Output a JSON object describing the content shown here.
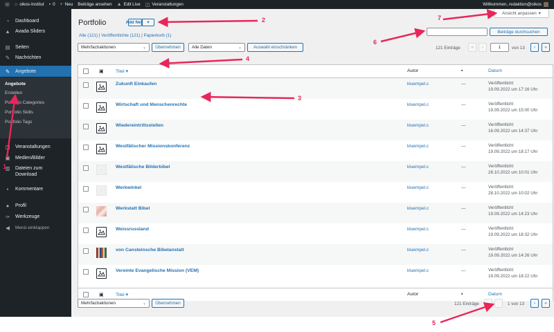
{
  "adminbar": {
    "site_name": "oikos-Institut",
    "comments_count": "0",
    "new_label": "Neu",
    "view_posts": "Beiträge ansehen",
    "edit_live": "Edit Live",
    "events": "Veranstaltungen",
    "greeting": "Willkommen, redaktion@oikos"
  },
  "sidebar": {
    "items": [
      {
        "label": "Dashboard",
        "icon": "dashboard-icon"
      },
      {
        "label": "Avada Sliders",
        "icon": "avada-icon"
      },
      {
        "label": "Seiten",
        "icon": "pages-icon"
      },
      {
        "label": "Nachrichten",
        "icon": "pin-icon"
      },
      {
        "label": "Angebote",
        "icon": "pin-icon"
      }
    ],
    "submenu": [
      "Angebote",
      "Erstellen",
      "Portfolio Categories",
      "Portfolio Skills",
      "Portfolio Tags"
    ],
    "items2": [
      {
        "label": "Veranstaltungen",
        "icon": "calendar-icon"
      },
      {
        "label": "Medien/Bilder",
        "icon": "media-icon"
      },
      {
        "label": "Dateien zum",
        "label2": "Download",
        "icon": "download-icon"
      },
      {
        "label": "Kommentare",
        "icon": "comments-icon"
      },
      {
        "label": "Profil",
        "icon": "user-icon"
      },
      {
        "label": "Werkzeuge",
        "icon": "wrench-icon"
      },
      {
        "label": "Menü einklappen",
        "icon": "collapse-icon"
      }
    ]
  },
  "header": {
    "title": "Portfolio",
    "add_new": "Add New",
    "screen_options": "Ansicht anpassen",
    "filters": {
      "all": "Alle (121)",
      "published": "Veröffentlichte (121)",
      "trash": "Papierkorb (1)",
      "sep": "|"
    },
    "search_button": "Beiträge durchsuchen"
  },
  "tablenav_top": {
    "bulk_select": "Mehrfachaktionen",
    "apply": "Übernehmen",
    "date_select": "Alle Daten",
    "filter": "Auswahl einschränken",
    "items_count": "121 Einträge",
    "page_value": "1",
    "page_of": "von 13",
    "first": "«",
    "prev": "‹",
    "next": "›",
    "last": "»"
  },
  "table": {
    "columns": {
      "title": "Titel",
      "author": "Autor",
      "date": "Datum"
    },
    "rows": [
      {
        "title": "Zukunft Einkaufen",
        "author": "kluempel.c",
        "comments": "—",
        "status": "Veröffentlicht",
        "date": "19.09.2022 um 17:16 Uhr",
        "thumb": "placeholder"
      },
      {
        "title": "Wirtschaft und Menschenrechte",
        "author": "kluempel.c",
        "comments": "—",
        "status": "Veröffentlicht",
        "date": "19.09.2022 um 15:00 Uhr",
        "thumb": "placeholder"
      },
      {
        "title": "Wiedereintrittsstellen",
        "author": "kluempel.c",
        "comments": "—",
        "status": "Veröffentlicht",
        "date": "16.09.2022 um 14:37 Uhr",
        "thumb": "placeholder"
      },
      {
        "title": "Westfälischer Missionskonferenz",
        "author": "kluempel.c",
        "comments": "—",
        "status": "Veröffentlicht",
        "date": "19.09.2022 um 18:17 Uhr",
        "thumb": "placeholder"
      },
      {
        "title": "Westfälische Bilderbibel",
        "author": "kluempel.c",
        "comments": "—",
        "status": "Veröffentlicht",
        "date": "28.10.2022 um 10:01 Uhr",
        "thumb": "blank"
      },
      {
        "title": "Werkwinkel",
        "author": "kluempel.c",
        "comments": "—",
        "status": "Veröffentlicht",
        "date": "28.10.2022 um 10:02 Uhr",
        "thumb": "blank"
      },
      {
        "title": "Werkstatt Bibel",
        "author": "kluempel.c",
        "comments": "—",
        "status": "Veröffentlicht",
        "date": "19.09.2022 um 14:23 Uhr",
        "thumb": "photo1"
      },
      {
        "title": "Weissrussland",
        "author": "kluempel.c",
        "comments": "—",
        "status": "Veröffentlicht",
        "date": "19.09.2022 um 18:32 Uhr",
        "thumb": "placeholder"
      },
      {
        "title": "von Cansteinsche Bibelanstalt",
        "author": "kluempel.c",
        "comments": "—",
        "status": "Veröffentlicht",
        "date": "19.09.2022 um 14:26 Uhr",
        "thumb": "photo2"
      },
      {
        "title": "Vereinte Evangelische Mission (VEM)",
        "author": "kluempel.c",
        "comments": "—",
        "status": "Veröffentlicht",
        "date": "19.09.2022 um 18:22 Uhr",
        "thumb": "placeholder"
      }
    ]
  },
  "tablenav_bottom": {
    "bulk_select": "Mehrfachaktionen",
    "apply": "Übernehmen",
    "items_count": "121 Einträge",
    "page_text": "1 von 13",
    "next": "›",
    "last": "»"
  },
  "annotations": [
    "1",
    "2",
    "3",
    "4",
    "5",
    "6",
    "7"
  ],
  "colors": {
    "accent": "#2271b1",
    "sidebar": "#1d2327",
    "annotation": "#e8265a"
  }
}
